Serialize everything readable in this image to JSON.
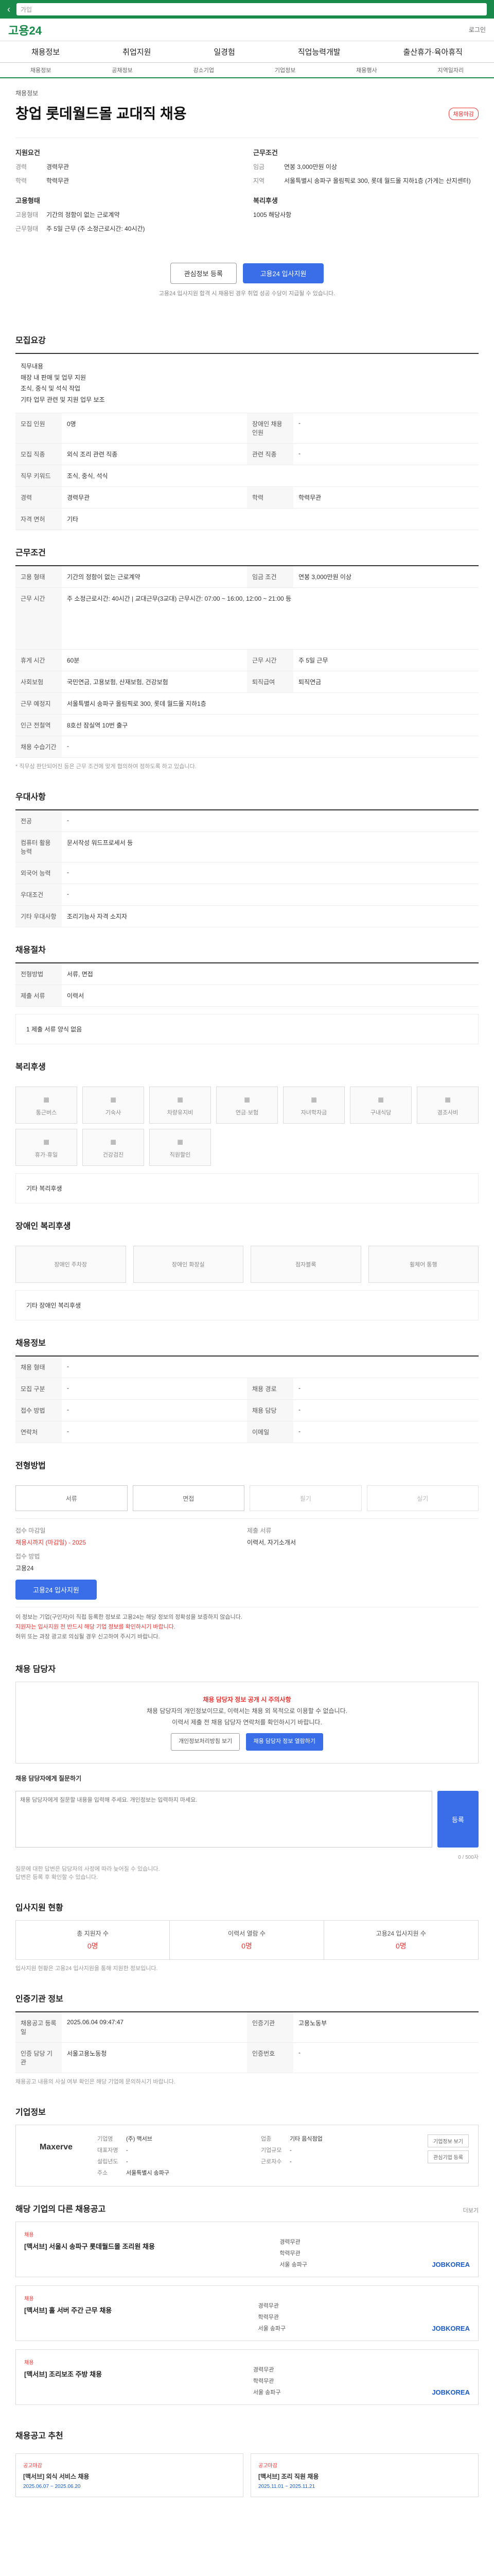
{
  "header": {
    "search_placeholder": "가입",
    "brand": "고용24",
    "login": "로그인"
  },
  "nav": [
    "채용정보",
    "취업지원",
    "일경험",
    "직업능력개발",
    "출산휴가·육아휴직"
  ],
  "subnav": [
    "채용정보",
    "공채정보",
    "강소기업",
    "기업정보",
    "채용행사",
    "지역일자리"
  ],
  "job": {
    "company": "채용정보",
    "title": "창업 롯데월드몰 교대직 채용",
    "badge": "채용마감",
    "left_head": "지원요건",
    "left": [
      {
        "k": "경력",
        "v": "경력무관"
      },
      {
        "k": "학력",
        "v": "학력무관"
      }
    ],
    "left_head2": "고용형태",
    "left2": [
      {
        "k": "고용형태",
        "v": "기간의 정함이 없는 근로계약"
      },
      {
        "k": "근무형태",
        "v": "주 5일 근무 (주 소정근로시간: 40시간)"
      }
    ],
    "right_head": "근무조건",
    "right": [
      {
        "k": "임금",
        "v": "연봉 3,000만원 이상"
      },
      {
        "k": "지역",
        "v": "서울특별시 송파구 올림픽로 300, 롯데 월드몰 지하1층 (가게는 산지센터)"
      }
    ],
    "right_head2": "복리후생",
    "right2": [
      {
        "k": "",
        "v": "1005 해당사항"
      }
    ],
    "btn_save": "관심정보 등록",
    "btn_apply": "고용24 입사지원",
    "small_note": "고용24 입사지원 합격 시 채용된 경우 취업 성공 수당이 지급될 수 있습니다."
  },
  "sec_requirements": {
    "title": "모집요강",
    "intro": [
      "직무내용",
      "매장 내 판매 및 업무 지원",
      "조식, 중식 및 석식 작업",
      "기타 업무 관련 및 지원 업무 보조"
    ],
    "rows": [
      {
        "k": "모집 인원",
        "v": "0명",
        "k2": "장애인 채용 인원",
        "v2": "-"
      },
      {
        "k": "모집 직종",
        "v": "외식 조리 관련 직종",
        "k2": "관련 직종",
        "v2": "-"
      },
      {
        "k": "직무 키워드",
        "v": "조식, 중식, 석식",
        "k2": "",
        "v2": ""
      },
      {
        "k": "경력",
        "v": "경력무관",
        "k2": "학력",
        "v2": "학력무관"
      },
      {
        "k": "자격 면허",
        "v": "기타",
        "k2": "",
        "v2": ""
      }
    ]
  },
  "sec_conditions": {
    "title": "근무조건",
    "rows": [
      {
        "k": "고용 형태",
        "v": "기간의 정함이 없는 근로계약",
        "k2": "임금 조건",
        "v2": "연봉 3,000만원 이상"
      },
      {
        "k": "근무 시간",
        "v": "주 소정근로시간: 40시간 | 교대근무(3교대) 근무시간: 07:00 ~ 16:00, 12:00 ~ 21:00 등"
      },
      {
        "k": "휴게 시간",
        "v": "60분",
        "k2": "근무 시간",
        "v2": "주 5일 근무"
      },
      {
        "k": "사회보험",
        "v": "국민연금, 고용보험, 산재보험, 건강보험",
        "k2": "퇴직급여",
        "v2": "퇴직연금"
      },
      {
        "k": "근무 예정지",
        "v": "서울특별시 송파구 올림픽로 300, 롯데 월드몰 지하1층",
        "k2": "",
        "v2": ""
      },
      {
        "k": "인근 전철역",
        "v": "8호선 잠실역 10번 출구",
        "k2": "",
        "v2": ""
      },
      {
        "k": "채용 수습기간",
        "v": "-",
        "k2": "",
        "v2": ""
      }
    ],
    "hint": "* 직무상 판단되어진 등은 근무 조건에 맞게 협의하여 정하도록 하고 있습니다."
  },
  "sec_preference": {
    "title": "우대사항",
    "rows": [
      {
        "k": "전공",
        "v": "-"
      },
      {
        "k": "컴퓨터 활용 능력",
        "v": "문서작성 워드프로세서 등"
      },
      {
        "k": "외국어 능력",
        "v": "-"
      },
      {
        "k": "우대조건",
        "v": "-"
      },
      {
        "k": "기타 우대사항",
        "v": "조리기능사 자격 소지자"
      }
    ]
  },
  "sec_process": {
    "title": "채용절차",
    "rows": [
      {
        "k": "전형방법",
        "v": "서류, 면접"
      },
      {
        "k": "제출 서류",
        "v": "이력서"
      }
    ],
    "note": "1 제출 서류 양식 없음"
  },
  "sec_welfare": {
    "title": "복리후생",
    "items": [
      "통근버스",
      "기숙사",
      "차량유지비",
      "연금·보험",
      "자녀학자금",
      "구내식당",
      "경조사비",
      "휴가·휴일",
      "건강검진",
      "직원할인"
    ],
    "note": "기타 복리후생"
  },
  "sec_disability": {
    "title": "장애인 복리후생",
    "items": [
      "장애인 주차장",
      "장애인 화장실",
      "점자블록",
      "휠체어 통행"
    ],
    "note": "기타 장애인 복리후생"
  },
  "sec_extra": {
    "title": "채용정보",
    "rows": [
      {
        "k": "채용 형태",
        "v": "-"
      },
      {
        "k": "모집 구분",
        "v": "-",
        "k2": "채용 경로",
        "v2": "-"
      },
      {
        "k": "접수 방법",
        "v": "-",
        "k2": "채용 담당",
        "v2": "-"
      },
      {
        "k": "연락처",
        "v": "-",
        "k2": "이메일",
        "v2": "-"
      }
    ]
  },
  "sec_apply": {
    "title": "전형방법",
    "steps": [
      "서류",
      "면접",
      "필기",
      "실기"
    ],
    "deadline_label": "접수 마감일",
    "deadline": "채용시까지 (마감일) - 2025",
    "apply_method_label": "접수 방법",
    "apply_method": "고용24",
    "submit_label": "제출 서류",
    "submit": "이력서, 자기소개서",
    "apply_btn": "고용24 입사지원",
    "warnings": [
      "이 정보는 기업(구인자)이 직접 등록한 정보로 고용24는 해당 정보의 정확성을 보증하지 않습니다.",
      "지원자는 입사지원 전 반드시 해당 기업 정보를 확인하시기 바랍니다.",
      "허위 또는 과장 광고로 의심될 경우 신고하여 주시기 바랍니다."
    ]
  },
  "sec_contact": {
    "title": "채용 담당자",
    "alert": "채용 담당자 정보 공개 시 주의사항",
    "lines": [
      "채용 담당자의 개인정보이므로, 이력서는 채용 외 목적으로 이용할 수 없습니다.",
      "이력서 제출 전 채용 담당자 연락처를 확인하시기 바랍니다."
    ],
    "btn1": "개인정보처리방침 보기",
    "btn2": "채용 담당자 정보 열람하기"
  },
  "sec_qa": {
    "title": "채용 담당자에게 질문하기",
    "placeholder": "채용 담당자에게 질문할 내용을 입력해 주세요. 개인정보는 입력하지 마세요.",
    "count": "0 / 500자",
    "send": "등록",
    "notes": [
      "질문에 대한 답변은 담당자의 사정에 따라 늦어질 수 있습니다.",
      "답변은 등록 후 확인할 수 있습니다."
    ]
  },
  "sec_stats": {
    "title": "입사지원 현황",
    "items": [
      {
        "label": "총 지원자 수",
        "n": "0명"
      },
      {
        "label": "이력서 열람 수",
        "n": "0명"
      },
      {
        "label": "고용24 입사지원 수",
        "n": "0명"
      }
    ],
    "note": "입사지원 현황은 고용24 입사지원을 통해 지원한 정보입니다."
  },
  "sec_info": {
    "title": "인증기관 정보",
    "rows": [
      {
        "k": "채용공고 등록일",
        "v": "2025.06.04 09:47:47",
        "k2": "인증기관",
        "v2": "고용노동부"
      },
      {
        "k": "인증 담당 기관",
        "v": "서울고용노동청",
        "k2": "인증번호",
        "v2": "-"
      }
    ],
    "notes": [
      "채용공고 내용의 사실 여부 확인은 해당 기업에 문의하시기 바랍니다."
    ]
  },
  "sec_company": {
    "title": "기업정보",
    "logo": "Maxerve",
    "info": [
      {
        "k": "기업명",
        "v": "(주) 맥서브"
      },
      {
        "k": "업종",
        "v": "기타 음식점업"
      },
      {
        "k": "대표자명",
        "v": "-"
      },
      {
        "k": "기업규모",
        "v": "-"
      },
      {
        "k": "설립년도",
        "v": "-"
      },
      {
        "k": "근로자수",
        "v": "-"
      },
      {
        "k": "주소",
        "v": "서울특별시 송파구"
      }
    ],
    "side": [
      "기업정보 보기",
      "관심기업 등록"
    ]
  },
  "sec_other": {
    "title": "해당 기업의 다른 채용공고",
    "more": "더보기",
    "jobs": [
      {
        "tag": "채용",
        "t": "[맥서브] 서울시 송파구 롯데월드몰 조리원 채용",
        "a": "경력무관",
        "b": "학력무관",
        "c": "서울 송파구",
        "logo": "JOBKOREA"
      },
      {
        "tag": "채용",
        "t": "[맥서브] 홀 서버 주간 근무 채용",
        "a": "경력무관",
        "b": "학력무관",
        "c": "서울 송파구",
        "logo": "JOBKOREA"
      },
      {
        "tag": "채용",
        "t": "[맥서브] 조리보조 주방 채용",
        "a": "경력무관",
        "b": "학력무관",
        "c": "서울 송파구",
        "logo": "JOBKOREA"
      }
    ]
  },
  "sec_reco": {
    "title": "채용공고 추천",
    "cards": [
      {
        "badge": "공고마감",
        "t": "[맥서브] 외식 서비스 채용",
        "d": "2025.06.07 ~ 2025.06.20"
      },
      {
        "badge": "공고마감",
        "t": "[맥서브] 조리 직원 채용",
        "d": "2025.11.01 ~ 2025.11.21"
      }
    ]
  }
}
